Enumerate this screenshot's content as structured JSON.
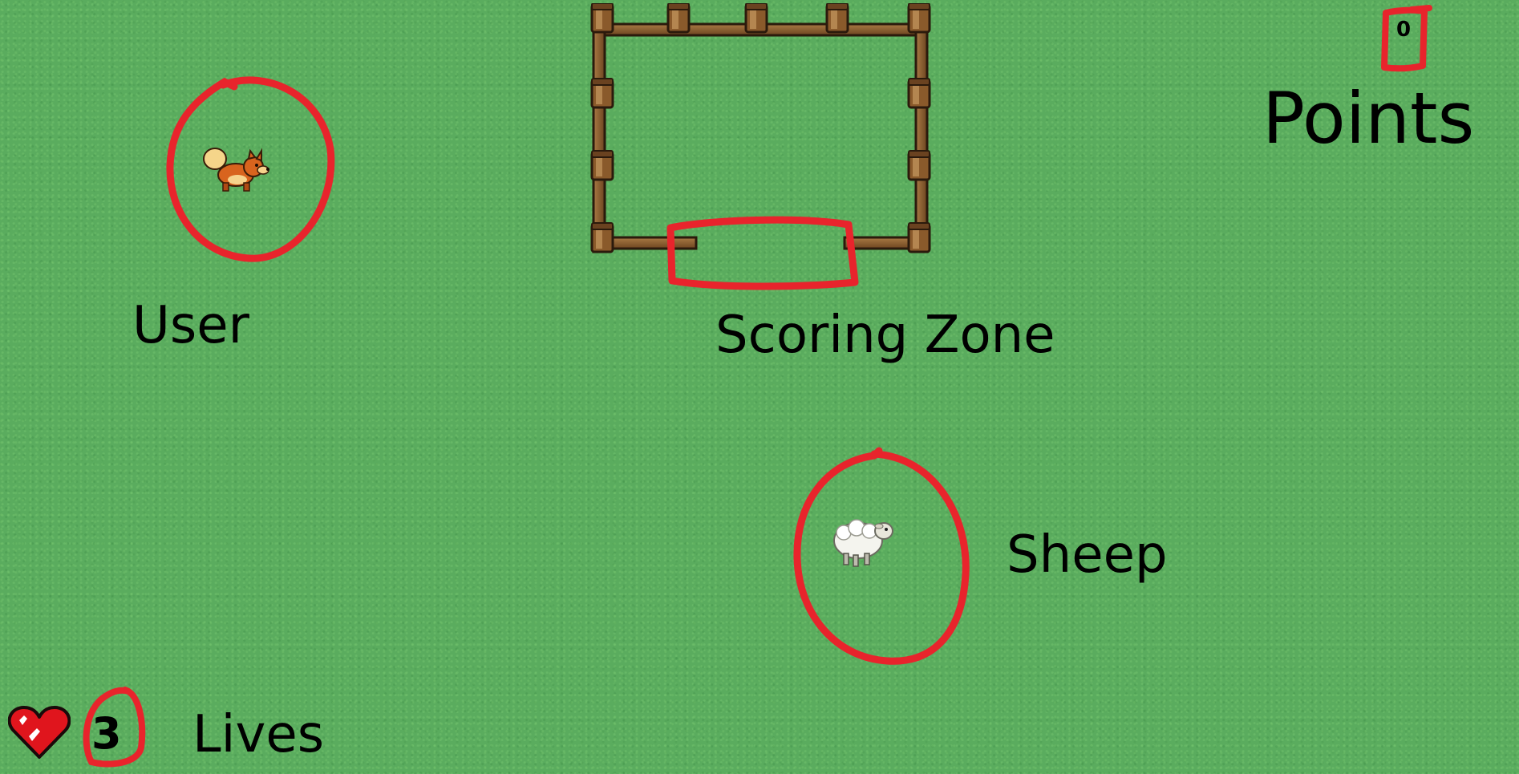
{
  "hud": {
    "points_value": "0",
    "points_label": "Points",
    "lives_value": "3",
    "lives_label": "Lives"
  },
  "labels": {
    "user": "User",
    "scoring_zone": "Scoring Zone",
    "sheep": "Sheep"
  },
  "colors": {
    "grass": "#5aac5e",
    "annotation": "#e8242c",
    "fence": "#8a5a2b"
  },
  "icons": {
    "player": "fox-icon",
    "sheep": "sheep-icon",
    "lives": "heart-icon",
    "pen": "fence"
  }
}
